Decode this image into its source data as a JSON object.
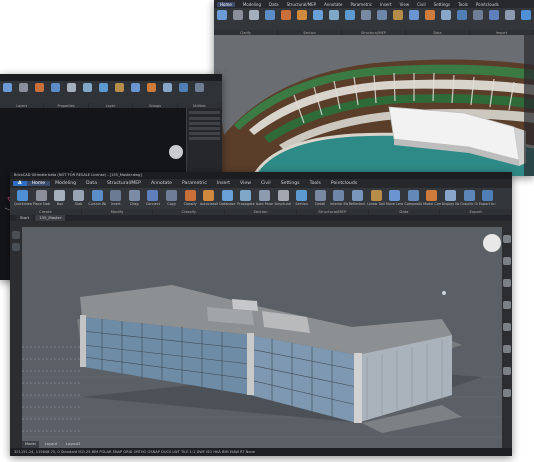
{
  "window_topright": {
    "ribbon_tabs": [
      "Home",
      "Modeling",
      "Data",
      "Structural/MEP",
      "Annotate",
      "Parametric",
      "Insert",
      "View",
      "Civil",
      "Settings",
      "Tools",
      "Pointclouds"
    ],
    "panel_titles": [
      "Clarify",
      "Section",
      "Structural/MEP",
      "Data",
      "Import"
    ]
  },
  "window_left": {
    "panel_titles": [
      "Layers",
      "Properties",
      "Layer",
      "Groups",
      "Utilities"
    ]
  },
  "window_main": {
    "title": "BricsCAD Ultimate beta (NOT FOR RESALE License) - [155_Master.dwg]",
    "menu": [
      "A",
      "Home",
      "Modeling",
      "Data",
      "Structural/MEP",
      "Annotate",
      "Parametric",
      "Insert",
      "View",
      "Civil",
      "Settings",
      "Tools",
      "Pointclouds"
    ],
    "ribbon_buttons": [
      {
        "label": "Quickdraw",
        "color": "#4e8fd6"
      },
      {
        "label": "Place Slab",
        "color": "#8a8f99"
      },
      {
        "label": "Box",
        "color": "#a6b0bd"
      },
      {
        "label": "Slab",
        "color": "#98a3b3"
      },
      {
        "label": "Curtain Wall",
        "color": "#5b8ec9"
      },
      {
        "label": "Insert",
        "color": "#6b7b93"
      },
      {
        "label": "Drag",
        "color": "#7d8ca6"
      },
      {
        "label": "Connect",
        "color": "#5f7fbd"
      },
      {
        "label": "Copy",
        "color": "#6f7e96"
      },
      {
        "label": "Classify",
        "color": "#c96f3a"
      },
      {
        "label": "Autoclassify",
        "color": "#d08a3e"
      },
      {
        "label": "Database",
        "color": "#6aa0d8"
      },
      {
        "label": "Propagate",
        "color": "#7fa7c7"
      },
      {
        "label": "Auto Parametrize",
        "color": "#8e9ab0"
      },
      {
        "label": "Structural Location",
        "color": "#a3a8b0"
      },
      {
        "label": "Section",
        "color": "#5c9ad1"
      },
      {
        "label": "Detail",
        "color": "#7a89a2"
      },
      {
        "label": "Interior Elevations",
        "color": "#6e86a8"
      },
      {
        "label": "Reflected Ceiling Plan",
        "color": "#7996bd"
      },
      {
        "label": "Linear Solid",
        "color": "#b88d4a"
      },
      {
        "label": "Move Level",
        "color": "#6b95d0"
      },
      {
        "label": "Composition Level of Detail",
        "color": "#6489b8"
      },
      {
        "label": "Model Composition Surfaces",
        "color": "#cf7b3c"
      },
      {
        "label": "Display Notes and Tools",
        "color": "#87a6c9"
      },
      {
        "label": "Graphic Overview",
        "color": "#5c86b8"
      },
      {
        "label": "Export to IFC",
        "color": "#4f7fb5"
      }
    ],
    "panel_titles": [
      "Create",
      "Modify",
      "Classify",
      "Section",
      "Structural/MEP",
      "Data",
      "Export"
    ],
    "doc_tabs": [
      "Start",
      "155_Master"
    ],
    "layout_tabs": [
      "Model",
      "Layout",
      "Layout1"
    ],
    "status_text": "321151.24, 115648.75, 0     Standard  ISO-25  BIM    POLAR  SNAP  GRID  ORTHO  OSNAP  DUCS  LWT  TILE  1:1  DWF  ISO  HKA  BIM  EIAW  RT  None"
  },
  "colors": {
    "viewport_bg": "#5b6066",
    "terrain": "#5a3e2a",
    "water": "#2e8a86",
    "grass": "#2f6b38",
    "building_light": "#e8e8e8",
    "glass": "#6f8fa8"
  }
}
